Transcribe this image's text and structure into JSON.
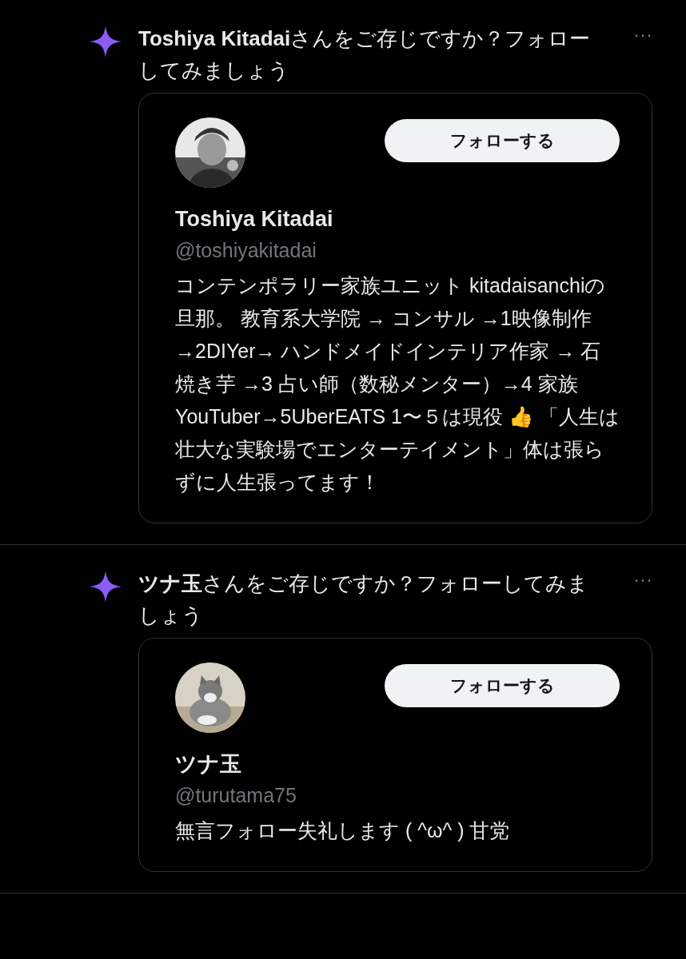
{
  "suggestions": [
    {
      "title_name": "Toshiya Kitadai",
      "title_rest": "さんをご存じですか？フォローしてみましょう",
      "more": "···",
      "user": {
        "name": "Toshiya Kitadai",
        "handle": "@toshiyakitadai",
        "follow": "フォローする",
        "bio": "コンテンポラリー家族ユニット kitadaisanchiの旦那。 教育系大学院 → コンサル →1映像制作 →2DIYer→ ハンドメイドインテリア作家 → 石焼き芋 →3 占い師（数秘メンター）→4 家族 YouTuber→5UberEATS 1〜５は現役 👍 「人生は壮大な実験場でエンターテイメント」体は張らずに人生張ってます！"
      }
    },
    {
      "title_name": "ツナ玉",
      "title_rest": "さんをご存じですか？フォローしてみましょう",
      "more": "···",
      "user": {
        "name": "ツナ玉",
        "handle": "@turutama75",
        "follow": "フォローする",
        "bio": "無言フォロー失礼します ( ^ω^ ) 甘党"
      }
    }
  ]
}
